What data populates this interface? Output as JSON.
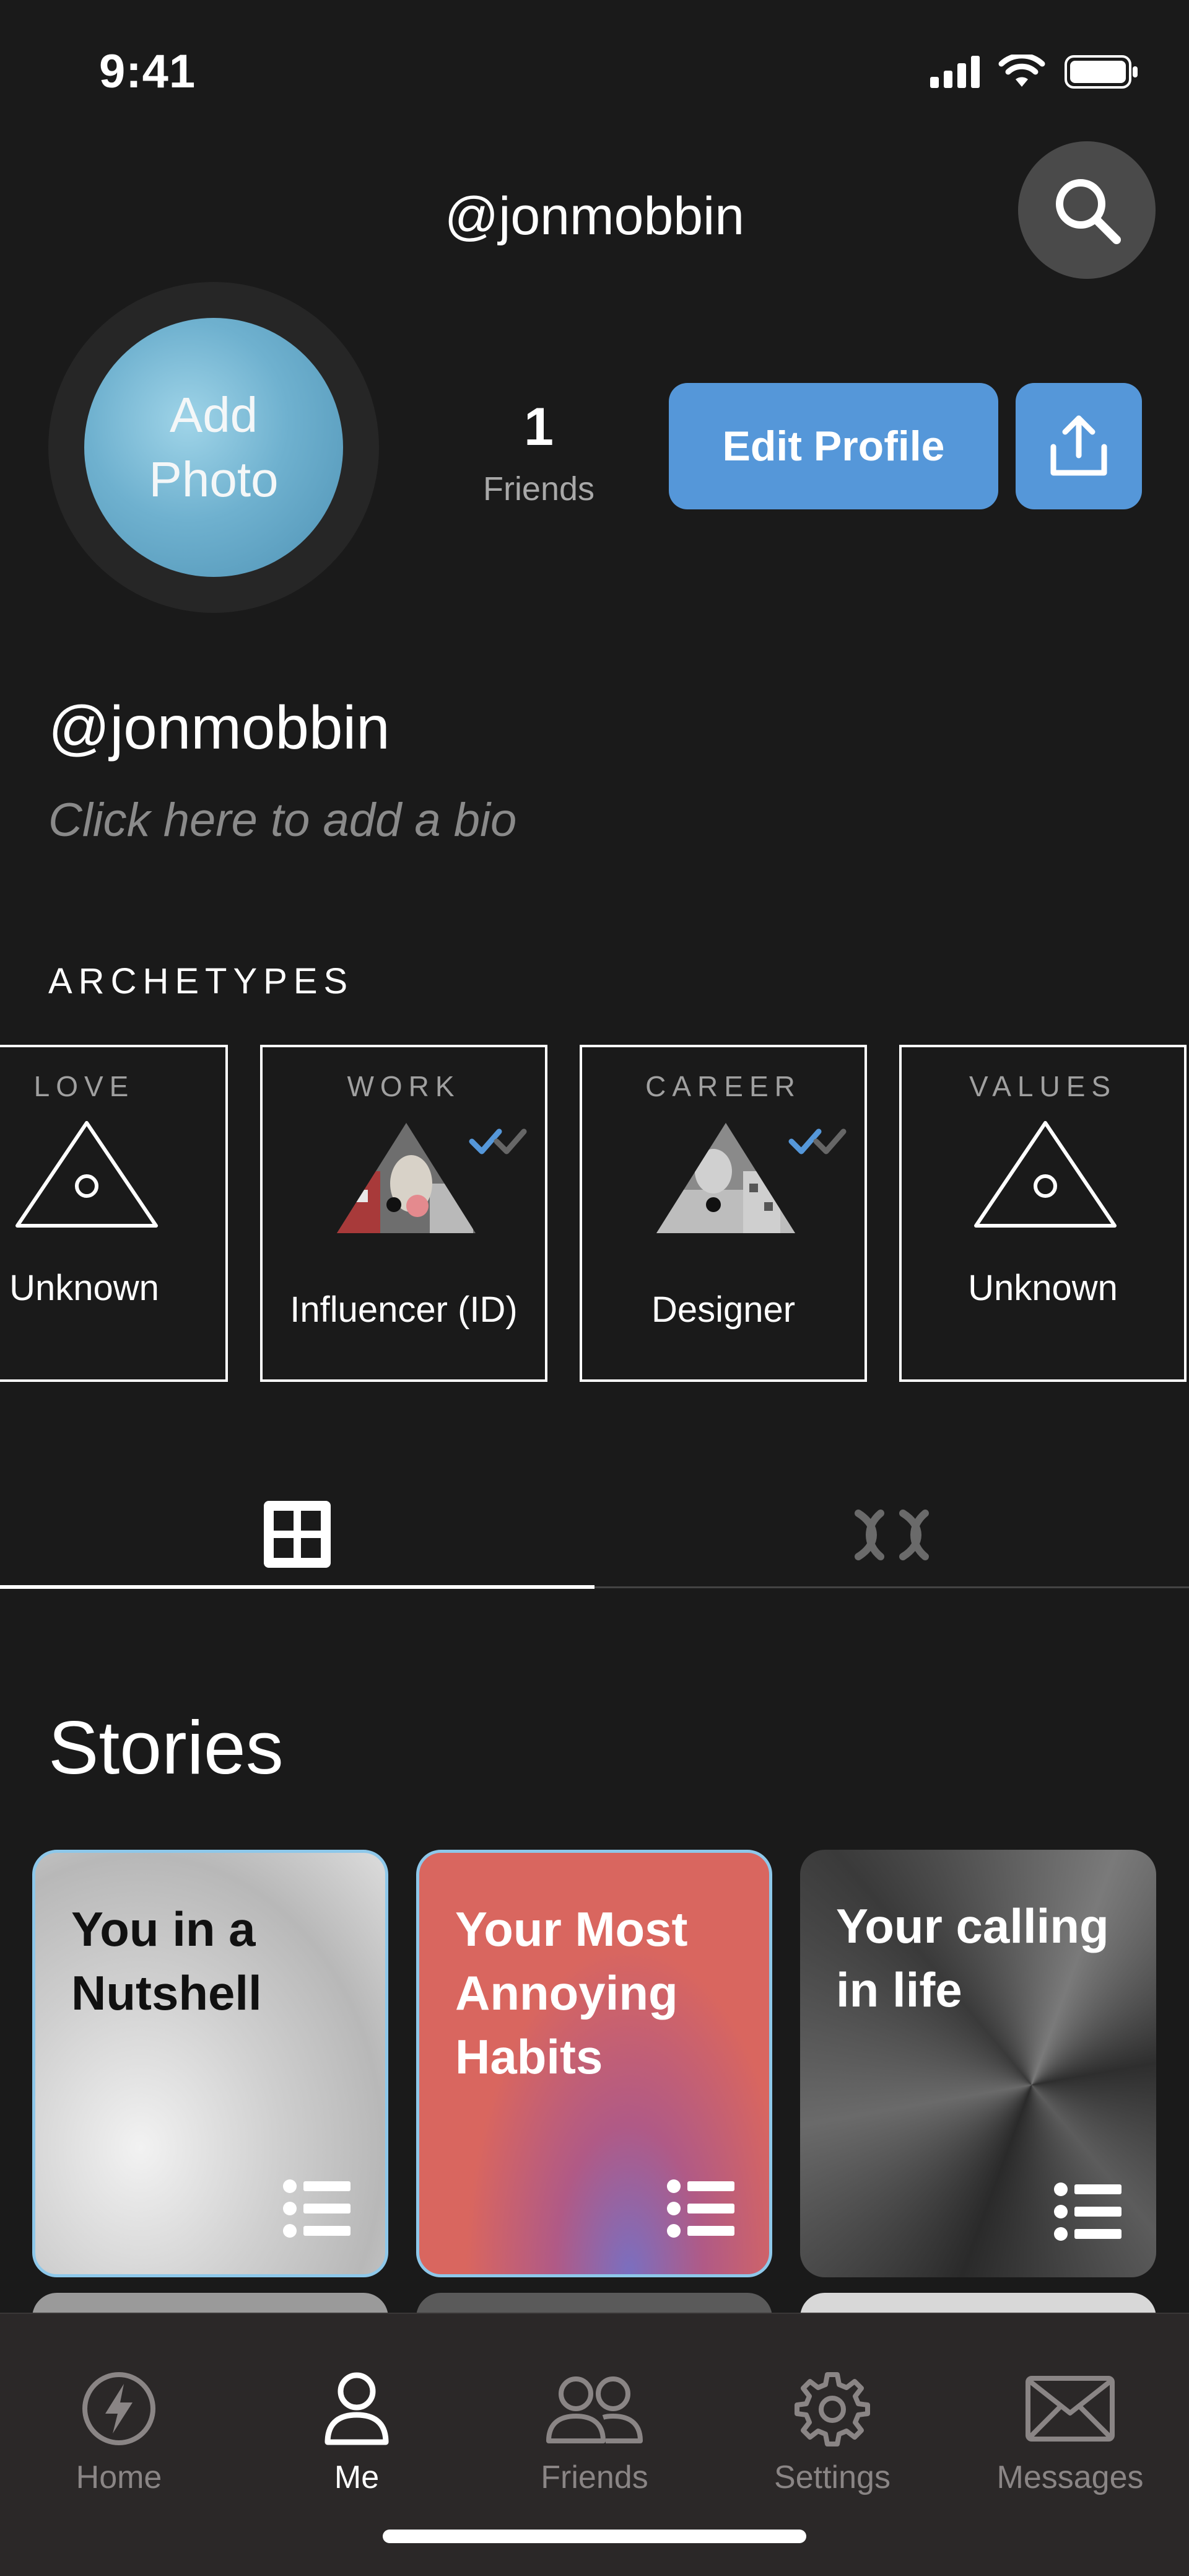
{
  "status_bar": {
    "time": "9:41"
  },
  "header": {
    "username": "@jonmobbin"
  },
  "profile": {
    "avatar_text_line1": "Add",
    "avatar_text_line2": "Photo",
    "friends_count": "1",
    "friends_label": "Friends",
    "edit_label": "Edit Profile",
    "username": "@jonmobbin",
    "bio_placeholder": "Click here to add a bio"
  },
  "archetypes": {
    "title": "ARCHETYPES",
    "cards": [
      {
        "category": "LOVE",
        "name": "Unknown"
      },
      {
        "category": "WORK",
        "name": "Influencer (ID)"
      },
      {
        "category": "CAREER",
        "name": "Designer"
      },
      {
        "category": "VALUES",
        "name": "Unknown"
      }
    ]
  },
  "stories": {
    "title": "Stories",
    "cards": [
      {
        "title": "You in a Nutshell"
      },
      {
        "title": "Your Most Annoying Habits"
      },
      {
        "title": "Your calling in life"
      }
    ]
  },
  "nav": {
    "items": [
      {
        "label": "Home",
        "icon": "lightning-icon"
      },
      {
        "label": "Me",
        "icon": "person-icon"
      },
      {
        "label": "Friends",
        "icon": "friends-icon"
      },
      {
        "label": "Settings",
        "icon": "gear-icon"
      },
      {
        "label": "Messages",
        "icon": "envelope-icon"
      }
    ],
    "active": "Me"
  },
  "colors": {
    "background": "#1a1a1a",
    "accent": "#5597d9",
    "nav_background": "#2b2828",
    "story_red": "#d9665f"
  }
}
